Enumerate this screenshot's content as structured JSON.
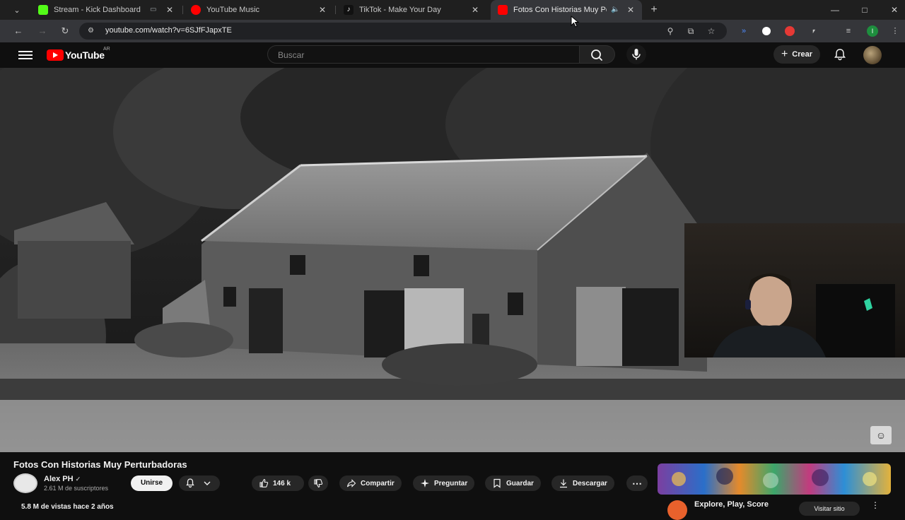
{
  "browser": {
    "tabs": [
      {
        "title": "Stream - Kick Dashboard",
        "favicon": "kick-icon",
        "color": "#53fc18"
      },
      {
        "title": "YouTube Music",
        "favicon": "youtube-music-icon",
        "color": "#ff0000"
      },
      {
        "title": "TikTok - Make Your Day",
        "favicon": "tiktok-icon",
        "color": "#ffffff"
      },
      {
        "title": "Fotos Con Historias Muy Perturbadoras",
        "favicon": "youtube-icon",
        "color": "#ff0000",
        "active": true
      }
    ],
    "url": "youtube.com/watch?v=6SJfFJapxTE"
  },
  "youtube": {
    "logo_text": "YouTube",
    "country_code": "AR",
    "search_placeholder": "Buscar",
    "create_label": "Crear"
  },
  "video": {
    "title": "Fotos Con Historias Muy Perturbadoras",
    "channel_name": "Alex PH",
    "subscribers": "2.61 M de suscriptores",
    "join_label": "Unirse",
    "likes": "146 k",
    "share_label": "Compartir",
    "ask_label": "Preguntar",
    "save_label": "Guardar",
    "download_label": "Descargar",
    "stats": "5.8 M de vistas  hace 2 años"
  },
  "ad": {
    "title": "Explore, Play, Score",
    "cta": "Visitar sitio"
  },
  "colors": {
    "accent": "#ff0000",
    "background": "#0f0f0f",
    "chip": "#272727"
  }
}
